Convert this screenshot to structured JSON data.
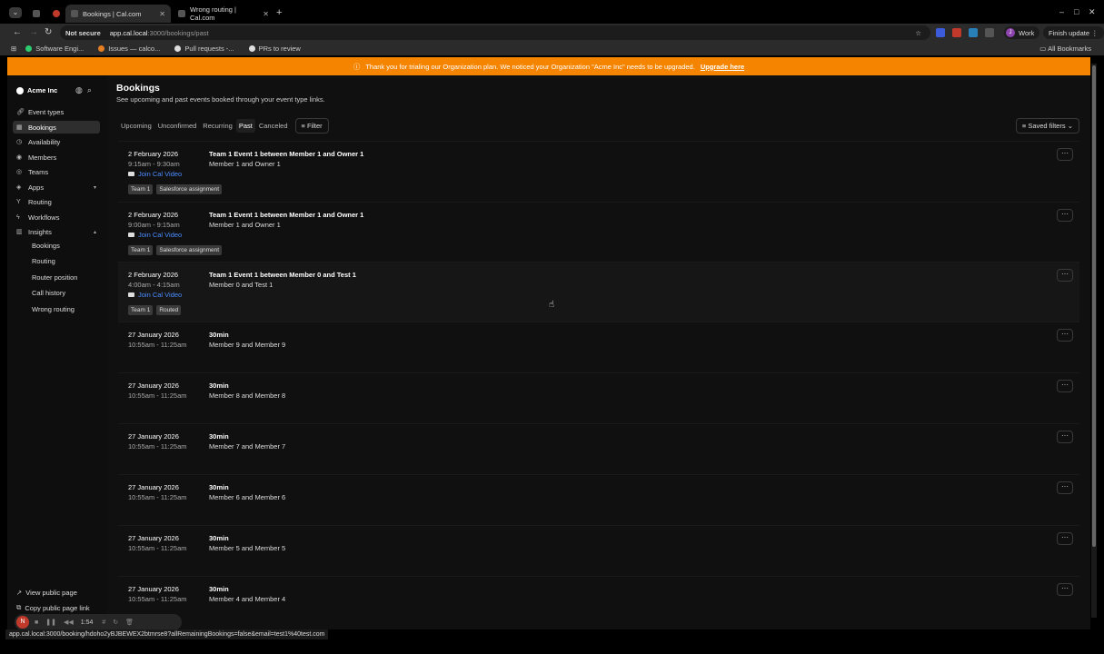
{
  "browser": {
    "tabs": [
      {
        "title": "Bookings | Cal.com",
        "active": true
      },
      {
        "title": "Wrong routing | Cal.com",
        "active": false
      }
    ],
    "url_warning": "Not secure",
    "url_host": "app.cal.local",
    "url_path": ":3000/bookings/past",
    "profile_initial": "J",
    "profile_label": "Work",
    "finish_update": "Finish update",
    "bookmarks": [
      "Software Engi...",
      "Issues — calco...",
      "Pull requests -...",
      "PRs to review"
    ],
    "all_bookmarks": "All Bookmarks",
    "status_url": "app.cal.local:3000/booking/hdoho2yBJBEWEX2btmrse8?allRemainingBookings=false&email=test1%40test.com"
  },
  "banner": {
    "text": "Thank you for trialing our Organization plan. We noticed your Organization \"Acme Inc\" needs to be upgraded.",
    "link": "Upgrade here",
    "color": "#f58400"
  },
  "sidebar": {
    "org_name": "Acme Inc",
    "items": [
      {
        "label": "Event types",
        "icon": "link-icon"
      },
      {
        "label": "Bookings",
        "icon": "calendar-icon",
        "active": true
      },
      {
        "label": "Availability",
        "icon": "clock-icon"
      },
      {
        "label": "Members",
        "icon": "user-icon"
      },
      {
        "label": "Teams",
        "icon": "users-icon"
      },
      {
        "label": "Apps",
        "icon": "grid-icon"
      },
      {
        "label": "Routing",
        "icon": "split-icon"
      },
      {
        "label": "Workflows",
        "icon": "zap-icon"
      },
      {
        "label": "Insights",
        "icon": "chart-icon"
      }
    ],
    "insights_sub": [
      "Bookings",
      "Routing",
      "Router position",
      "Call history",
      "Wrong routing"
    ],
    "footer": [
      "View public page",
      "Copy public page link"
    ]
  },
  "main": {
    "title": "Bookings",
    "subtitle": "See upcoming and past events booked through your event type links.",
    "tabs": [
      "Upcoming",
      "Unconfirmed",
      "Recurring",
      "Past",
      "Canceled"
    ],
    "active_tab": "Past",
    "filter": "Filter",
    "saved_filters": "Saved filters",
    "video_label": "Join Cal Video",
    "bookings": [
      {
        "date": "2 February 2026",
        "time": "9:15am - 9:30am",
        "title": "Team 1 Event 1 between Member 1 and Owner 1",
        "attendees": "Member 1 and Owner 1",
        "badges": [
          "Team 1",
          "Salesforce assignment"
        ]
      },
      {
        "date": "2 February 2026",
        "time": "9:00am - 9:15am",
        "title": "Team 1 Event 1 between Member 1 and Owner 1",
        "attendees": "Member 1 and Owner 1",
        "badges": [
          "Team 1",
          "Salesforce assignment"
        ]
      },
      {
        "date": "2 February 2026",
        "time": "4:00am - 4:15am",
        "title": "Team 1 Event 1 between Member 0 and Test 1",
        "attendees": "Member 0 and Test 1",
        "badges": [
          "Team 1",
          "Routed"
        ]
      },
      {
        "date": "27 January 2026",
        "time": "10:55am - 11:25am",
        "title": "30min",
        "attendees": "Member 9 and Member 9"
      },
      {
        "date": "27 January 2026",
        "time": "10:55am - 11:25am",
        "title": "30min",
        "attendees": "Member 8 and Member 8"
      },
      {
        "date": "27 January 2026",
        "time": "10:55am - 11:25am",
        "title": "30min",
        "attendees": "Member 7 and Member 7"
      },
      {
        "date": "27 January 2026",
        "time": "10:55am - 11:25am",
        "title": "30min",
        "attendees": "Member 6 and Member 6"
      },
      {
        "date": "27 January 2026",
        "time": "10:55am - 11:25am",
        "title": "30min",
        "attendees": "Member 5 and Member 5"
      },
      {
        "date": "27 January 2026",
        "time": "10:55am - 11:25am",
        "title": "30min",
        "attendees": "Member 4 and Member 4"
      }
    ]
  },
  "recorder": {
    "initial": "N",
    "timer": "1:54"
  }
}
